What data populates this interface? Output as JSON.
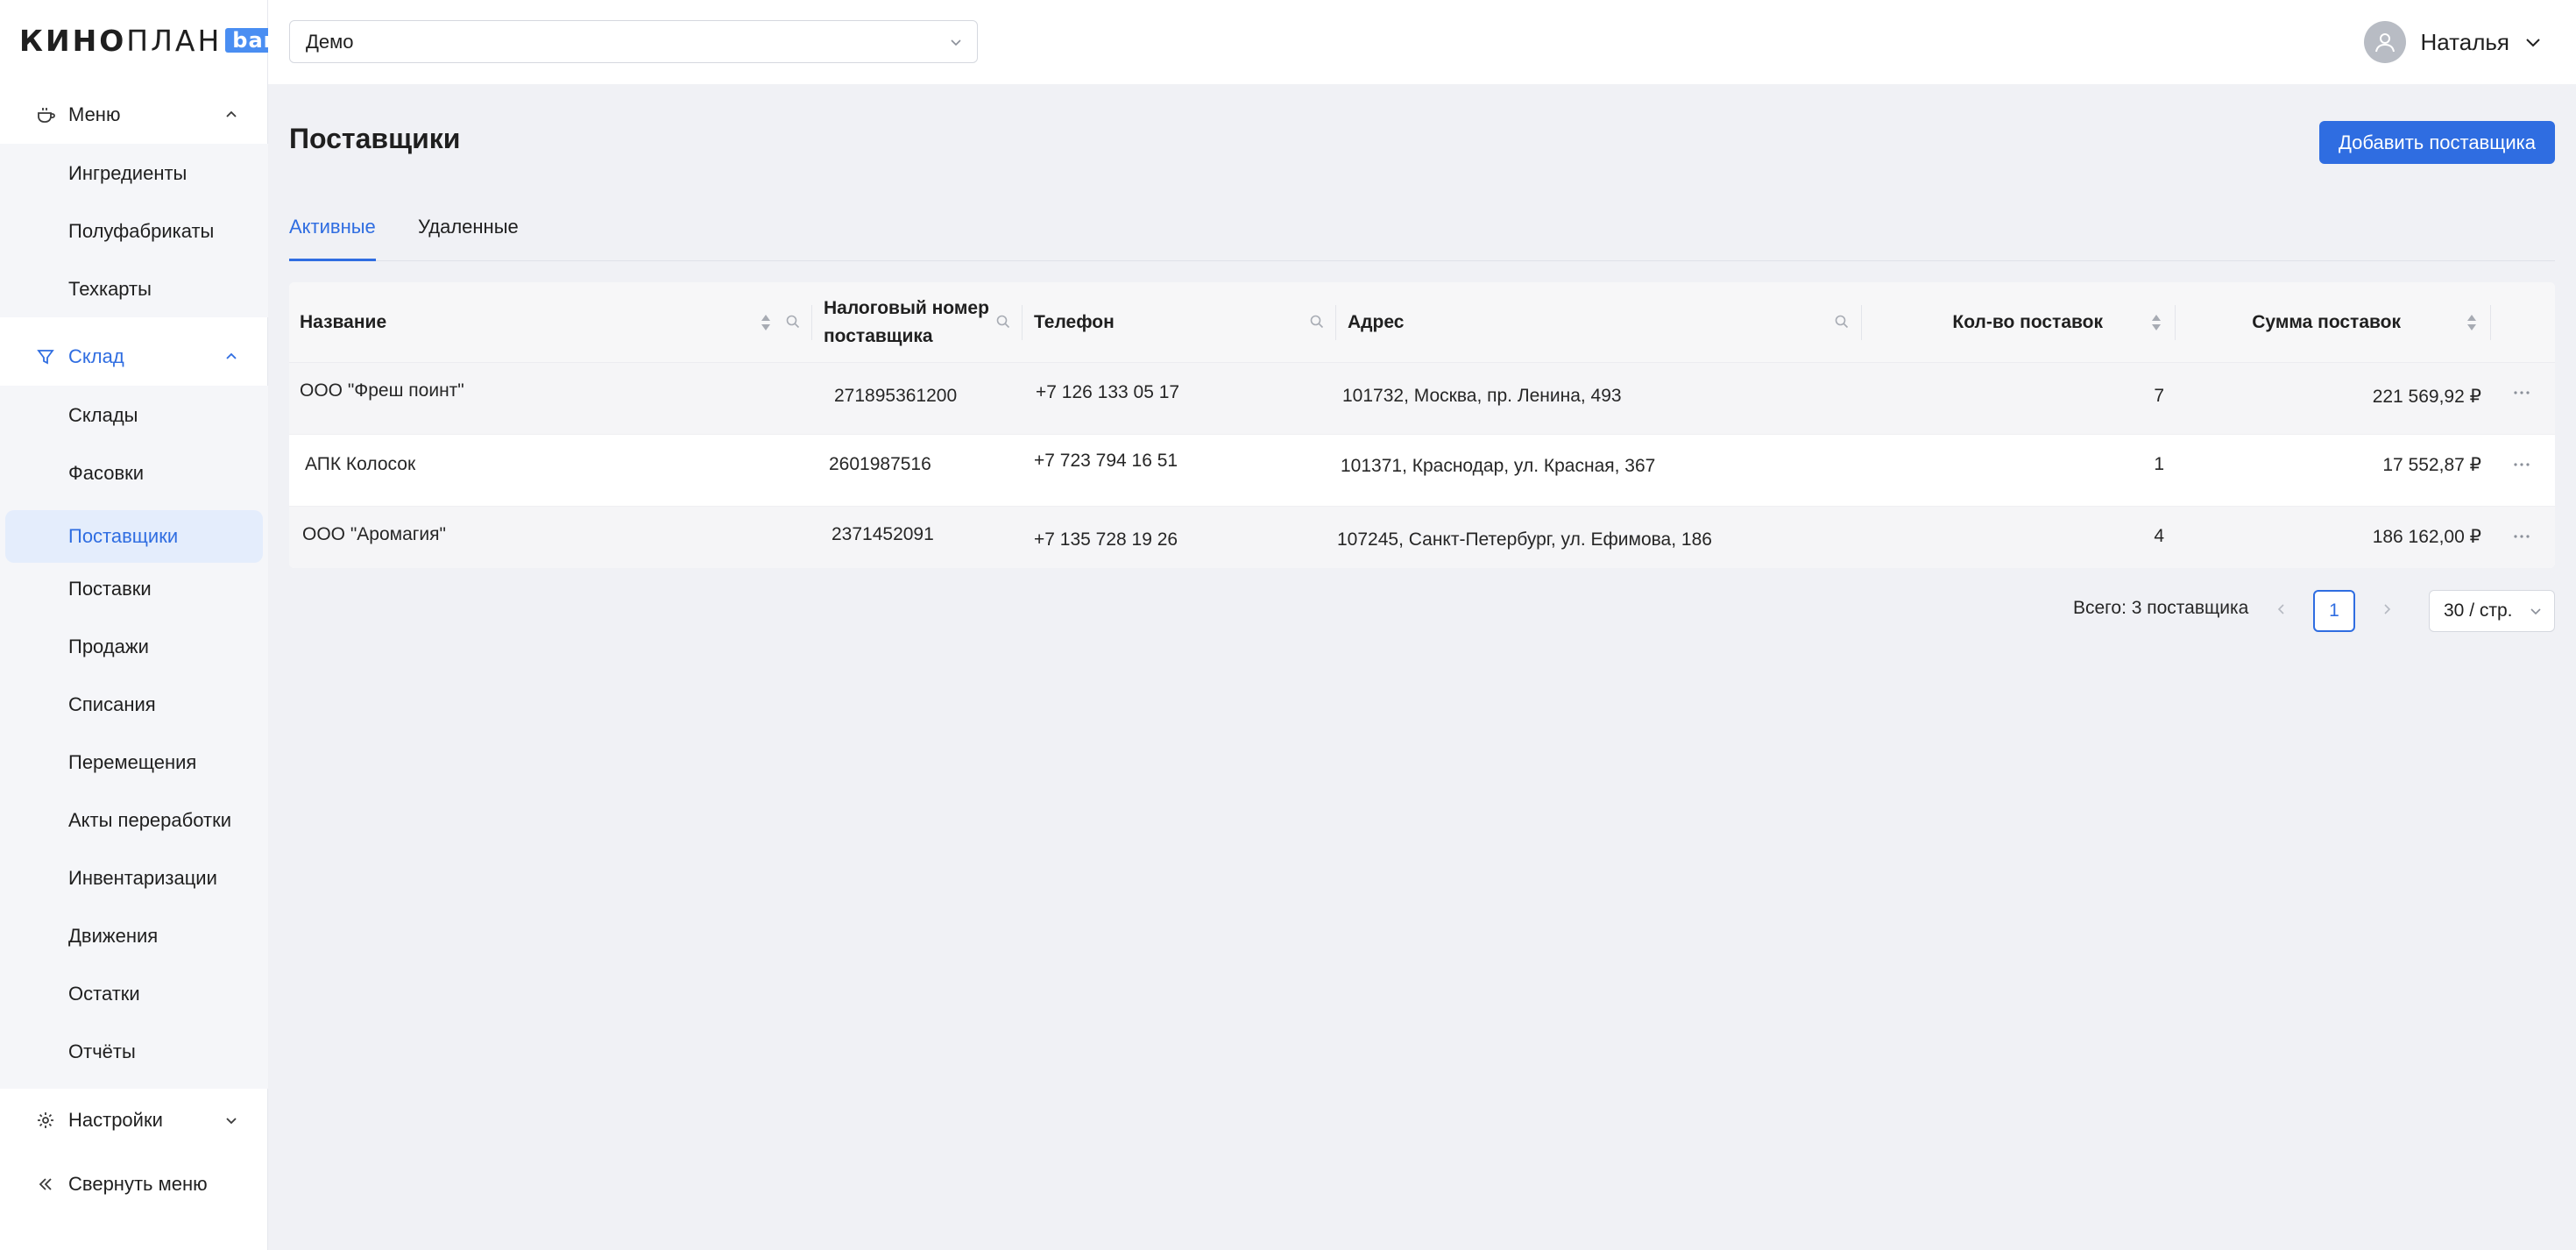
{
  "brand": {
    "logo_bold": "КИНО",
    "logo_light": "ПЛАН",
    "logo_badge": "bar"
  },
  "header": {
    "cinema_select": "Демо",
    "user_name": "Наталья"
  },
  "sidebar": {
    "groups": [
      {
        "label": "Меню",
        "icon": "menu-bowl-icon",
        "expanded": true
      },
      {
        "label": "Склад",
        "icon": "filter-funnel-icon",
        "expanded": true,
        "active": true
      },
      {
        "label": "Настройки",
        "icon": "gear-icon",
        "expanded": false
      }
    ],
    "menu_items": [
      "Ингредиенты",
      "Полуфабрикаты",
      "Техкарты"
    ],
    "warehouse_items": [
      "Склады",
      "Фасовки",
      "Поставщики",
      "Поставки",
      "Продажи",
      "Списания",
      "Перемещения",
      "Акты переработки",
      "Инвентаризации",
      "Движения",
      "Остатки",
      "Отчёты"
    ],
    "selected_item": "Поставщики",
    "collapse_label": "Свернуть меню"
  },
  "main": {
    "title": "Поставщики",
    "add_button": "Добавить поставщика",
    "tabs": [
      "Активные",
      "Удаленные"
    ],
    "active_tab": "Активные"
  },
  "table": {
    "columns": {
      "name": "Название",
      "tax_line1": "Налоговый номер",
      "tax_line2": "поставщика",
      "phone": "Телефон",
      "address": "Адрес",
      "count": "Кол-во поставок",
      "sum": "Сумма поставок"
    },
    "rows": [
      {
        "name": "ООО \"Фреш поинт\"",
        "tax": "271895361200",
        "phone": "+7 126 133 05 17",
        "address": "101732, Москва, пр. Ленина, 493",
        "count": "7",
        "sum": "221 569,92 ₽"
      },
      {
        "name": "АПК Колосок",
        "tax": "2601987516",
        "phone": "+7 723 794 16 51",
        "address": "101371, Краснодар, ул. Красная, 367",
        "count": "1",
        "sum": "17 552,87 ₽"
      },
      {
        "name": "ООО \"Аромагия\"",
        "tax": "2371452091",
        "phone": "+7 135 728 19 26",
        "address": "107245, Санкт-Петербург, ул. Ефимова, 186",
        "count": "4",
        "sum": "186 162,00 ₽"
      }
    ]
  },
  "pagination": {
    "total": "Всего: 3 поставщика",
    "current_page": "1",
    "page_size": "30 / стр."
  },
  "colors": {
    "accent": "#2f6de1",
    "badge": "#4a8ef2",
    "bg": "#f0f1f5"
  }
}
